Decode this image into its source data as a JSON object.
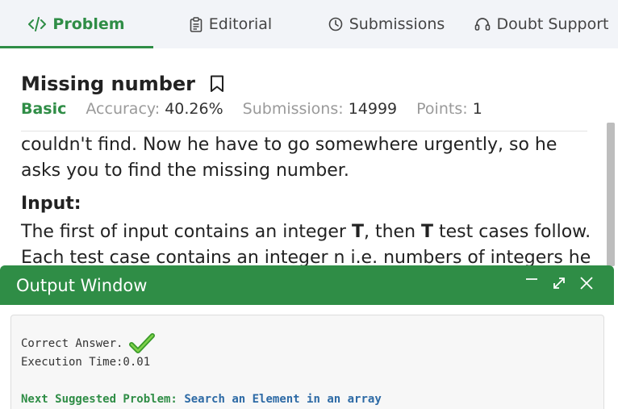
{
  "tabs": [
    {
      "label": "Problem",
      "icon": "code-icon",
      "active": true
    },
    {
      "label": "Editorial",
      "icon": "clipboard-icon",
      "active": false
    },
    {
      "label": "Submissions",
      "icon": "clock-icon",
      "active": false
    },
    {
      "label": "Doubt Support",
      "icon": "headset-icon",
      "active": false
    }
  ],
  "problem": {
    "title": "Missing number",
    "difficulty": "Basic",
    "accuracy_label": "Accuracy:",
    "accuracy_value": "40.26%",
    "submissions_label": "Submissions:",
    "submissions_value": "14999",
    "points_label": "Points:",
    "points_value": "1",
    "desc_line1": "couldn't find. Now he have to go somewhere urgently, so he",
    "desc_line2": "asks you to find the missing number.",
    "input_heading": "Input:",
    "input_line1_a": "The first of input contains an integer ",
    "input_line1_b": "T",
    "input_line1_c": ", then ",
    "input_line1_d": "T",
    "input_line1_e": " test cases follow.",
    "input_line2": "Each test case contains an integer n i.e. numbers of integers he"
  },
  "output_window": {
    "title": "Output Window",
    "result": "Correct Answer.",
    "execution_time": "Execution Time:0.01",
    "next_label": "Next Suggested Problem:",
    "next_link": "Search an Element in an array"
  },
  "colors": {
    "accent": "#2f8d46",
    "link": "#2d6aa5"
  }
}
